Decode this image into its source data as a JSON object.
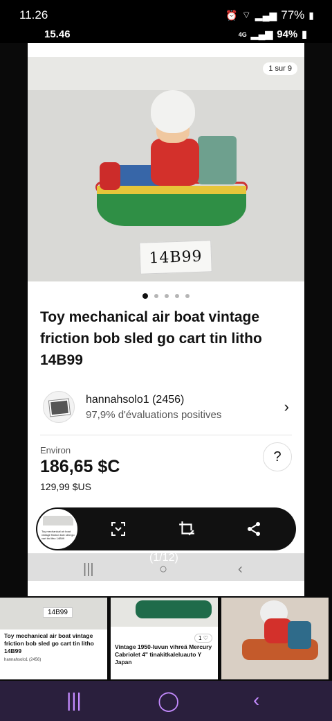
{
  "status_outer": {
    "time": "11.26",
    "battery": "77%"
  },
  "status_inner": {
    "time": "15.46",
    "network": "4G",
    "battery": "94%"
  },
  "listing": {
    "image_counter": "1 sur 9",
    "tag_text": "14B99",
    "title": "Toy mechanical air boat vintage friction bob sled go cart tin litho 14B99",
    "seller_name": "hannahsolo1 (2456)",
    "seller_feedback": "97,9% d'évaluations positives",
    "approx_label": "Environ",
    "price": "186,65 $C",
    "original_price": "129,99 $US",
    "help_label": "?"
  },
  "carousel": {
    "total_dots": 5,
    "active_index": 0
  },
  "screenshot_counter": "(1/12)",
  "recents": [
    {
      "text": "Toy mechanical air boat vintage friction bob sled go cart tin litho 14B99",
      "sub": "hannahsolo1 (2456)",
      "tag": "14B99"
    },
    {
      "text": "Vintage 1950-luvun vihreä Mercury Cabriolet 4\" tinakitkaleluauto Y Japan",
      "badge": "1"
    }
  ],
  "colors": {
    "accent_purple": "#c48bff",
    "toolbar_bg": "#111111"
  }
}
